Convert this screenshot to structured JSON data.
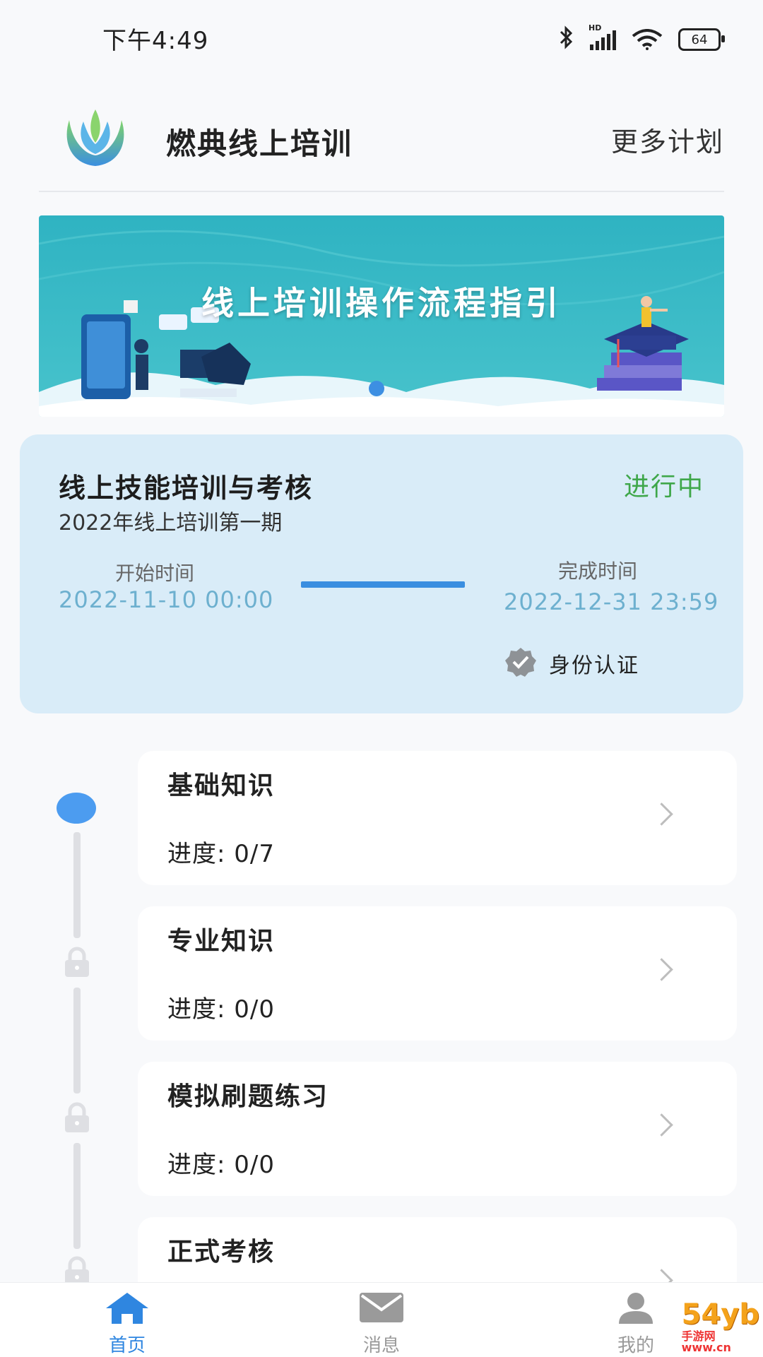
{
  "status_bar": {
    "time": "下午4:49",
    "battery": "64",
    "network": "HD"
  },
  "header": {
    "title": "燃典线上培训",
    "more_plans": "更多计划"
  },
  "banner": {
    "title": "线上培训操作流程指引"
  },
  "course": {
    "title": "线上技能培训与考核",
    "status": "进行中",
    "subtitle": "2022年线上培训第一期",
    "start_label": "开始时间",
    "start_time": "2022-11-10 00:00",
    "end_label": "完成时间",
    "end_time": "2022-12-31 23:59",
    "verify_label": "身份认证"
  },
  "modules": [
    {
      "title": "基础知识",
      "progress": "进度:  0/7",
      "locked": false
    },
    {
      "title": "专业知识",
      "progress": "进度:  0/0",
      "locked": true
    },
    {
      "title": "模拟刷题练习",
      "progress": "进度:  0/0",
      "locked": true
    },
    {
      "title": "正式考核",
      "progress": "",
      "locked": true
    }
  ],
  "nav": {
    "home": "首页",
    "messages": "消息",
    "mine": "我的"
  },
  "watermark": "54yb",
  "watermark_sub": "手游网",
  "watermark_domain": "www.cn",
  "colors": {
    "accent": "#3a8ee0",
    "status_active": "#3fa74a",
    "card_bg": "#d9ecf8",
    "nav_active": "#2f86e0",
    "nav_inactive": "#9a9a9a"
  }
}
